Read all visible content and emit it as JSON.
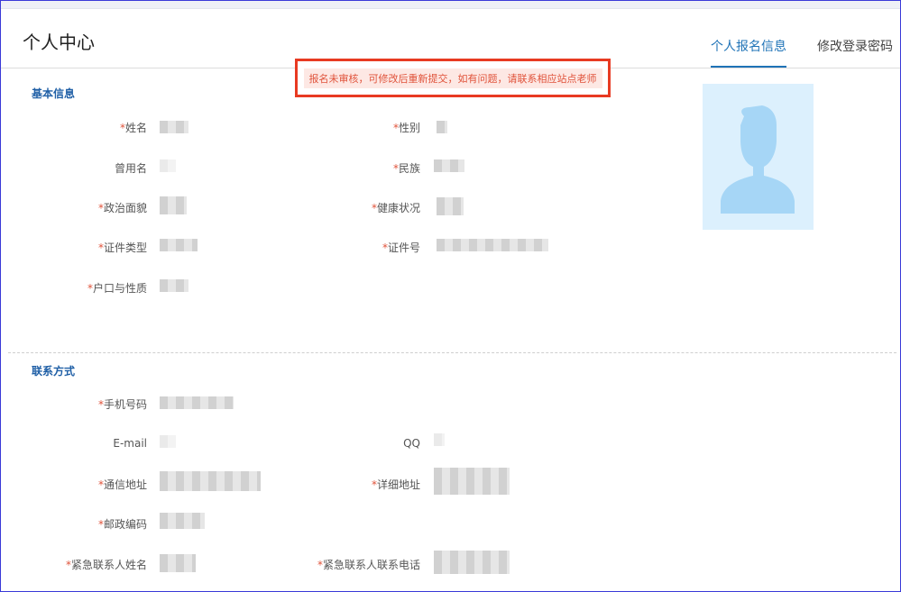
{
  "header": {
    "title": "个人中心",
    "tabs": [
      {
        "label": "个人报名信息",
        "active": true
      },
      {
        "label": "修改登录密码",
        "active": false
      }
    ]
  },
  "notice": {
    "text": "报名未审核，可修改后重新提交，如有问题，请联系相应站点老师"
  },
  "required_mark": "*",
  "basic_info": {
    "title": "基本信息",
    "fields": {
      "name": "姓名",
      "gender": "性别",
      "former_name": "曾用名",
      "ethnicity": "民族",
      "political_status": "政治面貌",
      "health": "健康状况",
      "id_type": "证件类型",
      "id_number": "证件号",
      "household": "户口与性质"
    }
  },
  "contact": {
    "title": "联系方式",
    "fields": {
      "phone": "手机号码",
      "email": "E-mail",
      "qq": "QQ",
      "mail_address": "通信地址",
      "detail_address": "详细地址",
      "postcode": "邮政编码",
      "emergency_name": "紧急联系人姓名",
      "emergency_phone": "紧急联系人联系电话"
    }
  },
  "colors": {
    "accent": "#1f73b7",
    "notice_border": "#e83a22",
    "notice_text": "#e0533b",
    "notice_bg": "#fde8e4",
    "avatar_bg": "#dcf0fd",
    "avatar_silhouette": "#a6d6f6"
  },
  "icons": {
    "avatar": "user-silhouette-icon"
  }
}
